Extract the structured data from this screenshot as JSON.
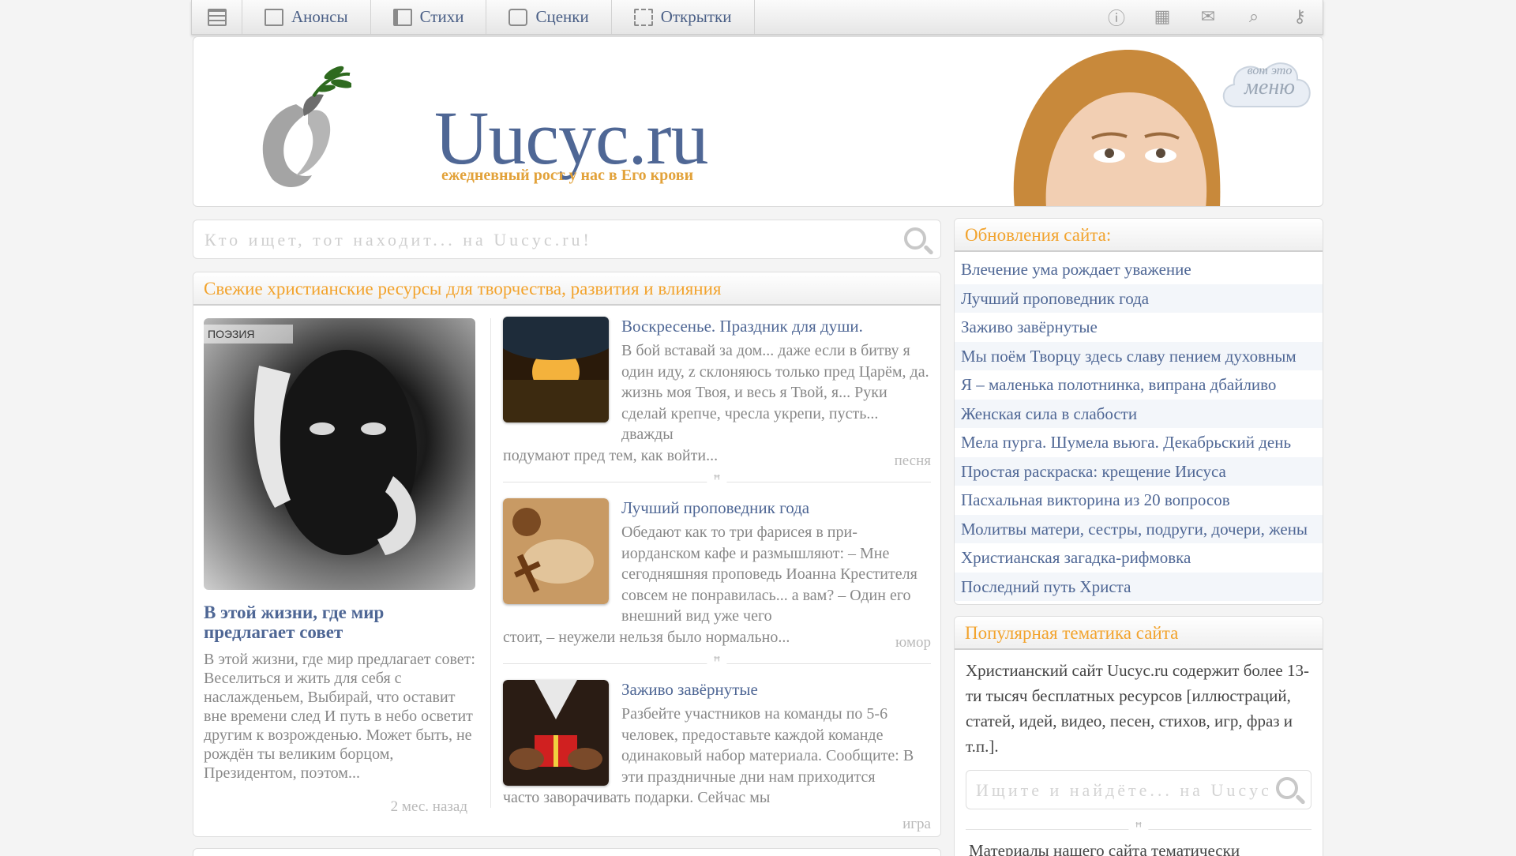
{
  "nav": {
    "items": [
      {
        "label": "Анонсы",
        "icon": "announce-icon"
      },
      {
        "label": "Стихи",
        "icon": "book-icon"
      },
      {
        "label": "Сценки",
        "icon": "chat-icon"
      },
      {
        "label": "Открытки",
        "icon": "postcard-icon"
      }
    ],
    "right_icons": [
      "info-icon",
      "gift-icon",
      "mail-icon",
      "search-icon",
      "key-icon"
    ]
  },
  "header": {
    "logo": "Uucyc.ru",
    "tagline": "ежедневный рост у нас в Его крови",
    "cloud_small": "вот это",
    "cloud_big": "меню"
  },
  "search": {
    "placeholder": "Кто ищет, тот находит... на Uucyc.ru!"
  },
  "main": {
    "title": "Свежие христианские ресурсы для творчества, развития и влияния",
    "feature": {
      "tag": "ПОЭЗИЯ",
      "title": "В этой жизни, где мир предлагает совет",
      "text": "В этой жизни, где мир предлагает совет: Веселиться и жить для себя с наслажденьем, Выбирай, что оставит вне времени след И путь в небо осветит другим к возрожденью. Может быть, не рождён ты великим борцом, Президентом, поэтом...",
      "date": "2 мес. назад"
    },
    "posts": [
      {
        "title": "Воскресенье. Праздник для души.",
        "text_lead": "В бой вставай за дом... даже если в битву я один иду, z склоняюсь только пред Царём, да. жизнь моя Твоя, и весь я Твой, я... Руки сделай крепче, чресла укрепи, пусть... дважды",
        "text_tail": "подумают пред тем, как войти...",
        "category": "песня"
      },
      {
        "title": "Лучший проповедник года",
        "text_lead": "Обедают как то три фарисея в при-иорданском кафе и размышляют: – Мне сегодняшняя проповедь Иоанна Крестителя совсем не понравилась... а вам? – Один его внешний вид уже чего",
        "text_tail": "стоит, – неужели нельзя было нормально...",
        "category": "юмор"
      },
      {
        "title": "Заживо завёрнутые",
        "text_lead": "Разбейте участников на команды по 5-6 человек, предоставьте каждой команде одинаковый набор материала. Сообщите: В эти праздничные дни нам приходится",
        "text_tail": "часто заворачивать подарки. Сейчас мы",
        "category": "игра"
      }
    ],
    "ornament": "ꟸ"
  },
  "updates": {
    "title": "Обновления сайта:",
    "items": [
      "Влечение ума рождает уважение",
      "Лучший проповедник года",
      "Заживо завёрнутые",
      "Мы поём Творцу здесь славу пением духовным",
      "Я – маленька полотнинка, випрана дбайливо",
      "Женская сила в слабости",
      "Мела пурга. Шумела вьюга. Декабрьский день",
      "Простая раскраска: крещение Иисуса",
      "Пасхальная викторина из 20 вопросов",
      "Молитвы матери, сестры, подруги, дочери, жены",
      "Христианская загадка-рифмовка",
      "Последний путь Христа"
    ]
  },
  "popular": {
    "title": "Популярная тематика сайта",
    "text": "Христианский сайт Uucyc.ru содержит более 13-ти тысяч бесплатных ресурсов [иллюстраций, статей, идей, видео, песен, стихов, игр, фраз и т.п.].",
    "search_placeholder": "Ищите и найдёте... на Uucyc.ru!",
    "more": "Материалы нашего сайта тематически"
  },
  "colors": {
    "accent": "#f2a32d",
    "link": "#4f6795",
    "muted": "#888888"
  }
}
